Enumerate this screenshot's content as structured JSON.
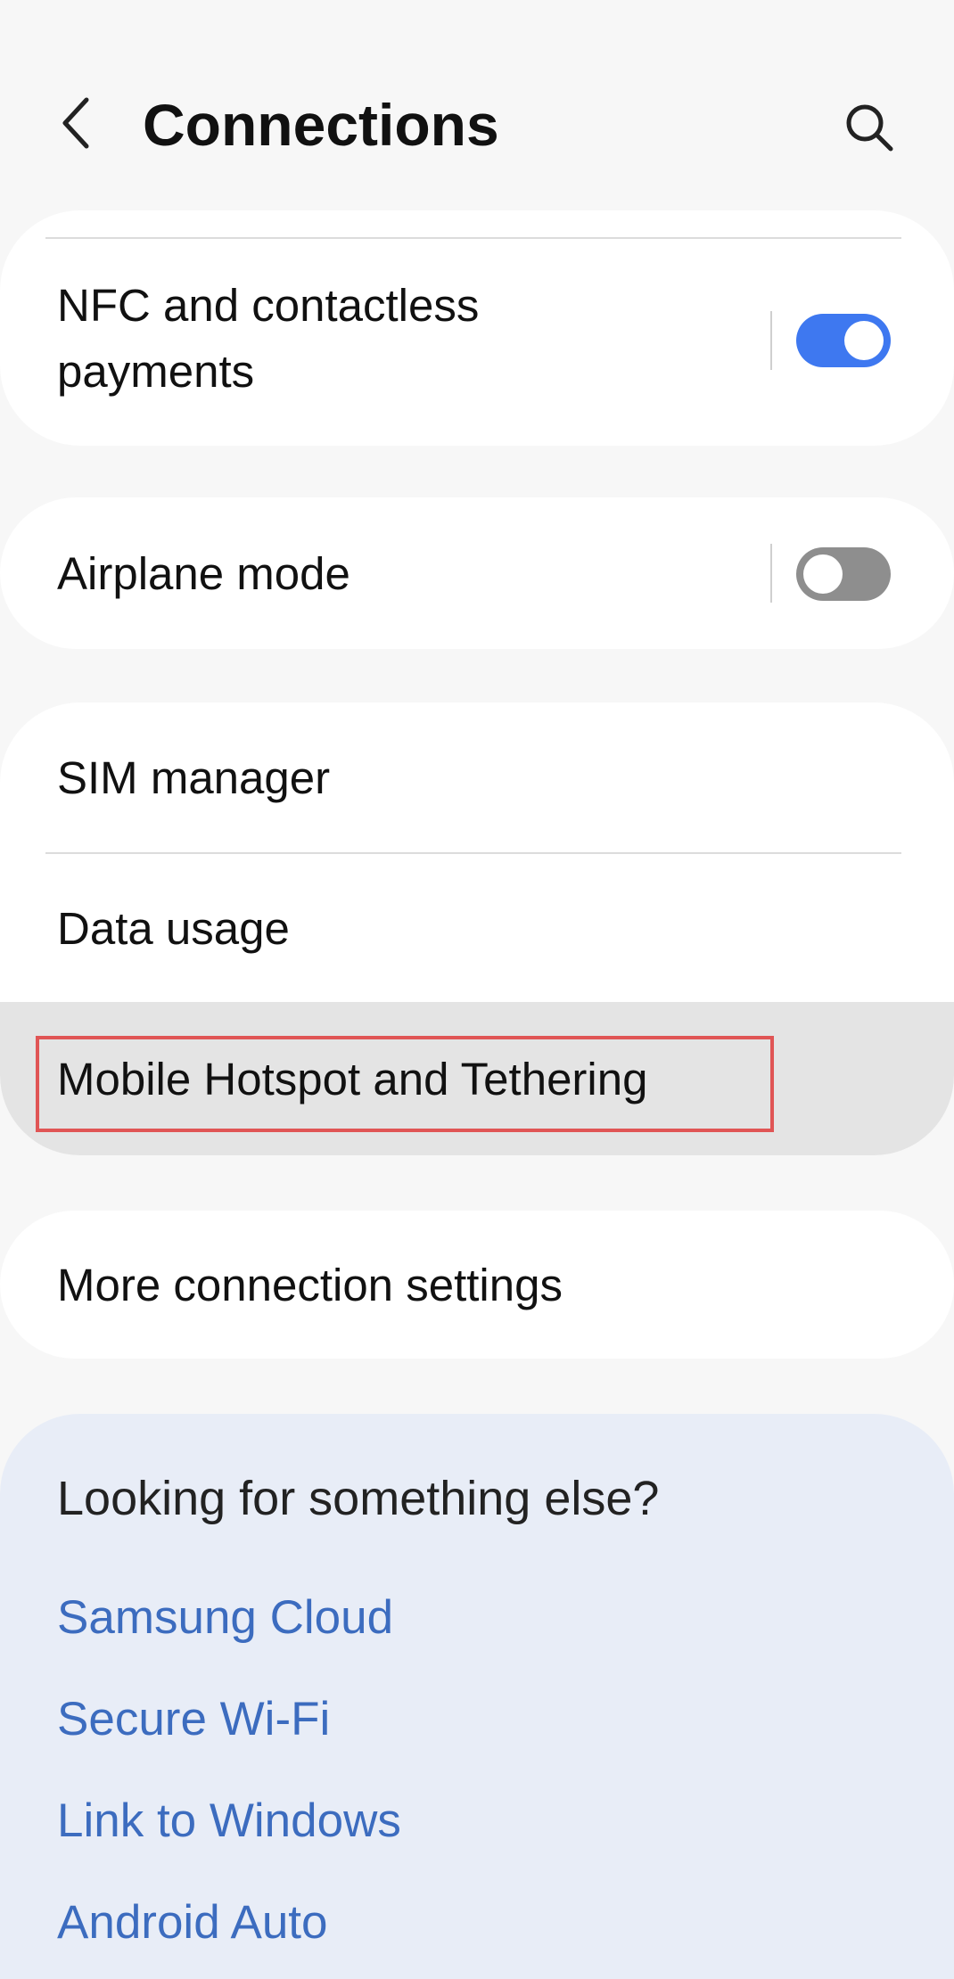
{
  "header": {
    "title": "Connections",
    "back_icon": "chevron-left-icon",
    "search_icon": "search-icon"
  },
  "settings": {
    "nfc": {
      "label_line1": "NFC and contactless",
      "label_line2": "payments",
      "enabled": true
    },
    "airplane": {
      "label": "Airplane mode",
      "enabled": false
    },
    "sim_manager": {
      "label": "SIM manager"
    },
    "data_usage": {
      "label": "Data usage"
    },
    "hotspot": {
      "label": "Mobile Hotspot and Tethering"
    },
    "more": {
      "label": "More connection settings"
    }
  },
  "suggestions": {
    "title": "Looking for something else?",
    "links": [
      "Samsung Cloud",
      "Secure Wi-Fi",
      "Link to Windows",
      "Android Auto"
    ]
  },
  "colors": {
    "toggle_on": "#3e78f0",
    "toggle_off": "#8e8e8e",
    "link": "#3c6cbf",
    "highlight_border": "#e05555"
  }
}
